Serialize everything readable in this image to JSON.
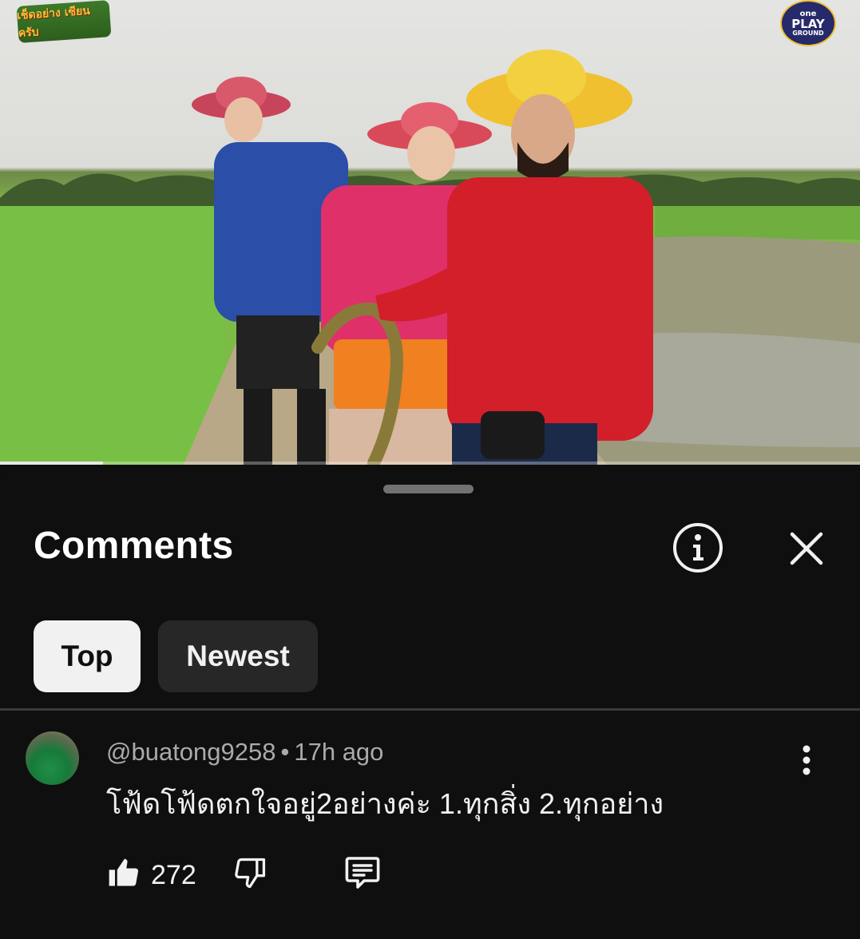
{
  "video": {
    "logo_left": "เช็ดอย่าง เซียนครับ",
    "logo_right": {
      "line1": "one",
      "line2": "PLAY",
      "line3": "GROUND"
    },
    "progress_fraction": 0.12
  },
  "comments_sheet": {
    "title": "Comments",
    "sort_chips": [
      {
        "label": "Top",
        "selected": true
      },
      {
        "label": "Newest",
        "selected": false
      }
    ]
  },
  "comments": [
    {
      "author": "@buatong9258",
      "separator": "•",
      "time": "17h ago",
      "text": "โฟ้ดโฟ้ดตกใจอยู่2อย่างค่ะ 1.ทุกสิ่ง 2.ทุกอย่าง",
      "likes": "272"
    }
  ],
  "colors": {
    "background": "#0f0f0f",
    "chip_selected": "#f1f1f1",
    "chip_unselected": "#272727",
    "meta_text": "#aaaaaa"
  },
  "icons": [
    "info-icon",
    "close-icon",
    "more-vert-icon",
    "thumb-up-icon",
    "thumb-down-icon",
    "reply-icon"
  ]
}
